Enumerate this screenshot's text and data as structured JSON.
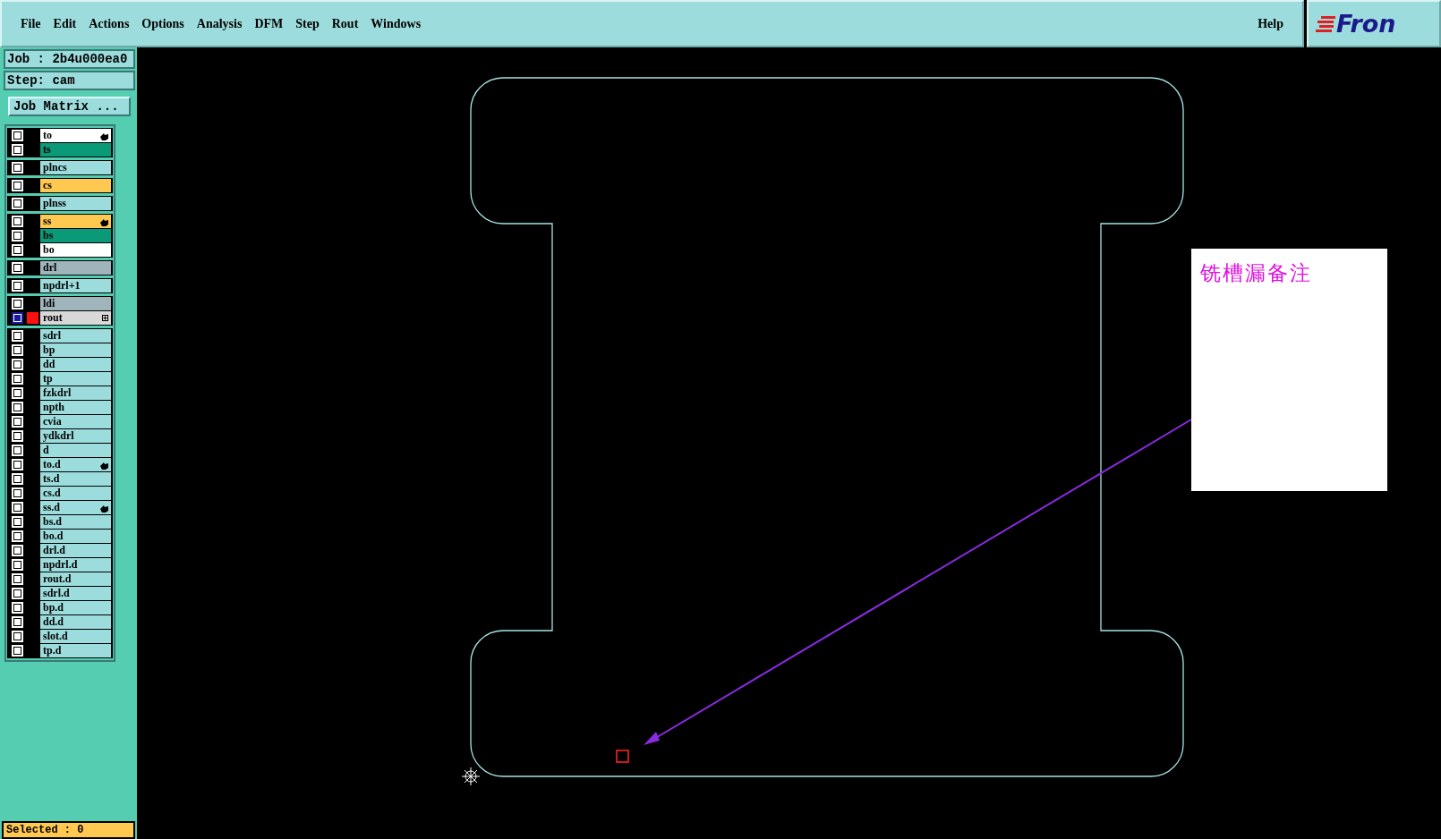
{
  "menu": [
    "File",
    "Edit",
    "Actions",
    "Options",
    "Analysis",
    "DFM",
    "Step",
    "Rout",
    "Windows"
  ],
  "help": "Help",
  "logo": "Fron",
  "job": "Job : 2b4u000ea0",
  "step": "Step: cam",
  "job_matrix": "Job Matrix ...",
  "layer_groups": [
    {
      "layers": [
        {
          "name": "to",
          "color": "#ffffff",
          "marked": true,
          "active": false
        },
        {
          "name": "ts",
          "color": "#0a9a78",
          "marked": false,
          "active": false
        }
      ]
    },
    {
      "layers": [
        {
          "name": "plncs",
          "color": "#9ddcdc",
          "marked": false,
          "active": false
        }
      ]
    },
    {
      "layers": [
        {
          "name": "cs",
          "color": "#ffc850",
          "marked": false,
          "active": false
        }
      ]
    },
    {
      "layers": [
        {
          "name": "plnss",
          "color": "#9ddcdc",
          "marked": false,
          "active": false
        }
      ]
    },
    {
      "layers": [
        {
          "name": "ss",
          "color": "#ffc850",
          "marked": true,
          "active": false
        },
        {
          "name": "bs",
          "color": "#0a9a78",
          "marked": false,
          "active": false
        },
        {
          "name": "bo",
          "color": "#ffffff",
          "marked": false,
          "active": false
        }
      ]
    },
    {
      "layers": [
        {
          "name": "drl",
          "color": "#a0b4bc",
          "marked": false,
          "active": false
        }
      ]
    },
    {
      "layers": [
        {
          "name": "npdrl+1",
          "color": "#9ddcdc",
          "marked": false,
          "active": false
        }
      ]
    },
    {
      "layers": [
        {
          "name": "ldi",
          "color": "#a0b4bc",
          "marked": false,
          "active": false
        },
        {
          "name": "rout",
          "color": "#d8d8d8",
          "marked": false,
          "active": true
        }
      ]
    },
    {
      "layers": [
        {
          "name": "sdrl",
          "color": "#9ddcdc",
          "marked": false,
          "active": false
        },
        {
          "name": "bp",
          "color": "#9ddcdc",
          "marked": false,
          "active": false
        },
        {
          "name": "dd",
          "color": "#9ddcdc",
          "marked": false,
          "active": false
        },
        {
          "name": "tp",
          "color": "#9ddcdc",
          "marked": false,
          "active": false
        },
        {
          "name": "fzkdrl",
          "color": "#9ddcdc",
          "marked": false,
          "active": false
        },
        {
          "name": "npth",
          "color": "#9ddcdc",
          "marked": false,
          "active": false
        },
        {
          "name": "cvia",
          "color": "#9ddcdc",
          "marked": false,
          "active": false
        },
        {
          "name": "ydkdrl",
          "color": "#9ddcdc",
          "marked": false,
          "active": false
        },
        {
          "name": "d",
          "color": "#9ddcdc",
          "marked": false,
          "active": false
        },
        {
          "name": "to.d",
          "color": "#9ddcdc",
          "marked": true,
          "active": false
        },
        {
          "name": "ts.d",
          "color": "#9ddcdc",
          "marked": false,
          "active": false
        },
        {
          "name": "cs.d",
          "color": "#9ddcdc",
          "marked": false,
          "active": false
        },
        {
          "name": "ss.d",
          "color": "#9ddcdc",
          "marked": true,
          "active": false
        },
        {
          "name": "bs.d",
          "color": "#9ddcdc",
          "marked": false,
          "active": false
        },
        {
          "name": "bo.d",
          "color": "#9ddcdc",
          "marked": false,
          "active": false
        },
        {
          "name": "drl.d",
          "color": "#9ddcdc",
          "marked": false,
          "active": false
        },
        {
          "name": "npdrl.d",
          "color": "#9ddcdc",
          "marked": false,
          "active": false
        },
        {
          "name": "rout.d",
          "color": "#9ddcdc",
          "marked": false,
          "active": false
        },
        {
          "name": "sdrl.d",
          "color": "#9ddcdc",
          "marked": false,
          "active": false
        },
        {
          "name": "bp.d",
          "color": "#9ddcdc",
          "marked": false,
          "active": false
        },
        {
          "name": "dd.d",
          "color": "#9ddcdc",
          "marked": false,
          "active": false
        },
        {
          "name": "slot.d",
          "color": "#9ddcdc",
          "marked": false,
          "active": false
        },
        {
          "name": "tp.d",
          "color": "#9ddcdc",
          "marked": false,
          "active": false
        }
      ]
    }
  ],
  "status": "Selected : 0",
  "note": "铣槽漏备注"
}
